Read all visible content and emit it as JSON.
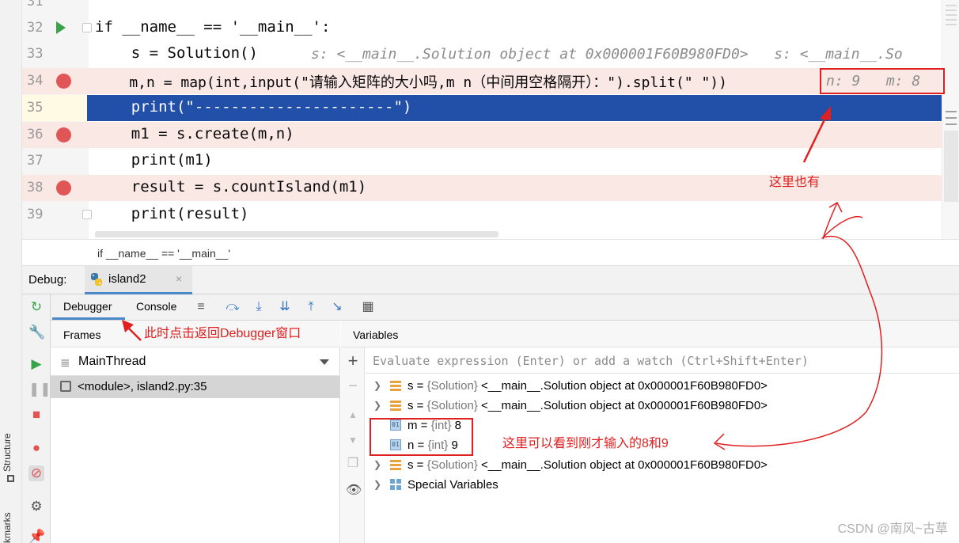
{
  "editor": {
    "lines": [
      {
        "num": "31"
      },
      {
        "num": "32",
        "code": "if __name__ == '__main__':"
      },
      {
        "num": "33",
        "code": "    s = Solution()",
        "inlay": "s: <__main__.Solution object at 0x000001F60B980FD0>   s: <__main__.So"
      },
      {
        "num": "34",
        "code": "    m,n = map(int,input(\"请输入矩阵的大小吗,m n（中间用空格隔开）：\").split(\" \"))",
        "inlay": "n: 9   m: 8"
      },
      {
        "num": "35",
        "code": "    print(\"----------------------\")"
      },
      {
        "num": "36",
        "code": "    m1 = s.create(m,n)"
      },
      {
        "num": "37",
        "code": "    print(m1)"
      },
      {
        "num": "38",
        "code": "    result = s.countIsland(m1)"
      },
      {
        "num": "39",
        "code": "    print(result)"
      }
    ],
    "breadcrumb": "if __name__ == '__main__'"
  },
  "debug": {
    "title": "Debug:",
    "session_tab": "island2",
    "close_glyph": "×",
    "tabs": {
      "debugger": "Debugger",
      "console": "Console"
    },
    "frames": {
      "header": "Frames",
      "thread": "MainThread",
      "frame": "<module>, island2.py:35"
    },
    "variables": {
      "header": "Variables",
      "eval_placeholder": "Evaluate expression (Enter) or add a watch (Ctrl+Shift+Enter)",
      "rows": [
        {
          "name": "s",
          "type": "{Solution}",
          "value": "<__main__.Solution object at 0x000001F60B980FD0>"
        },
        {
          "name": "s",
          "type": "{Solution}",
          "value": "<__main__.Solution object at 0x000001F60B980FD0>"
        },
        {
          "name": "m",
          "type": "{int}",
          "value": "8"
        },
        {
          "name": "n",
          "type": "{int}",
          "value": "9"
        },
        {
          "name": "s",
          "type": "{Solution}",
          "value": "<__main__.Solution object at 0x000001F60B980FD0>"
        },
        {
          "name": "Special Variables"
        }
      ]
    }
  },
  "side_labels": {
    "structure": "Structure",
    "bookmarks": "kmarks"
  },
  "annotations": {
    "also_here": "这里也有",
    "back_to_debugger": "此时点击返回Debugger窗口",
    "see_values": "这里可以看到刚才输入的8和9"
  },
  "watermark": "CSDN @南风~古草",
  "colors": {
    "breakpoint": "#e05555",
    "current_line": "#2250a8",
    "annotation": "#e02020",
    "accent": "#4a88c7"
  }
}
